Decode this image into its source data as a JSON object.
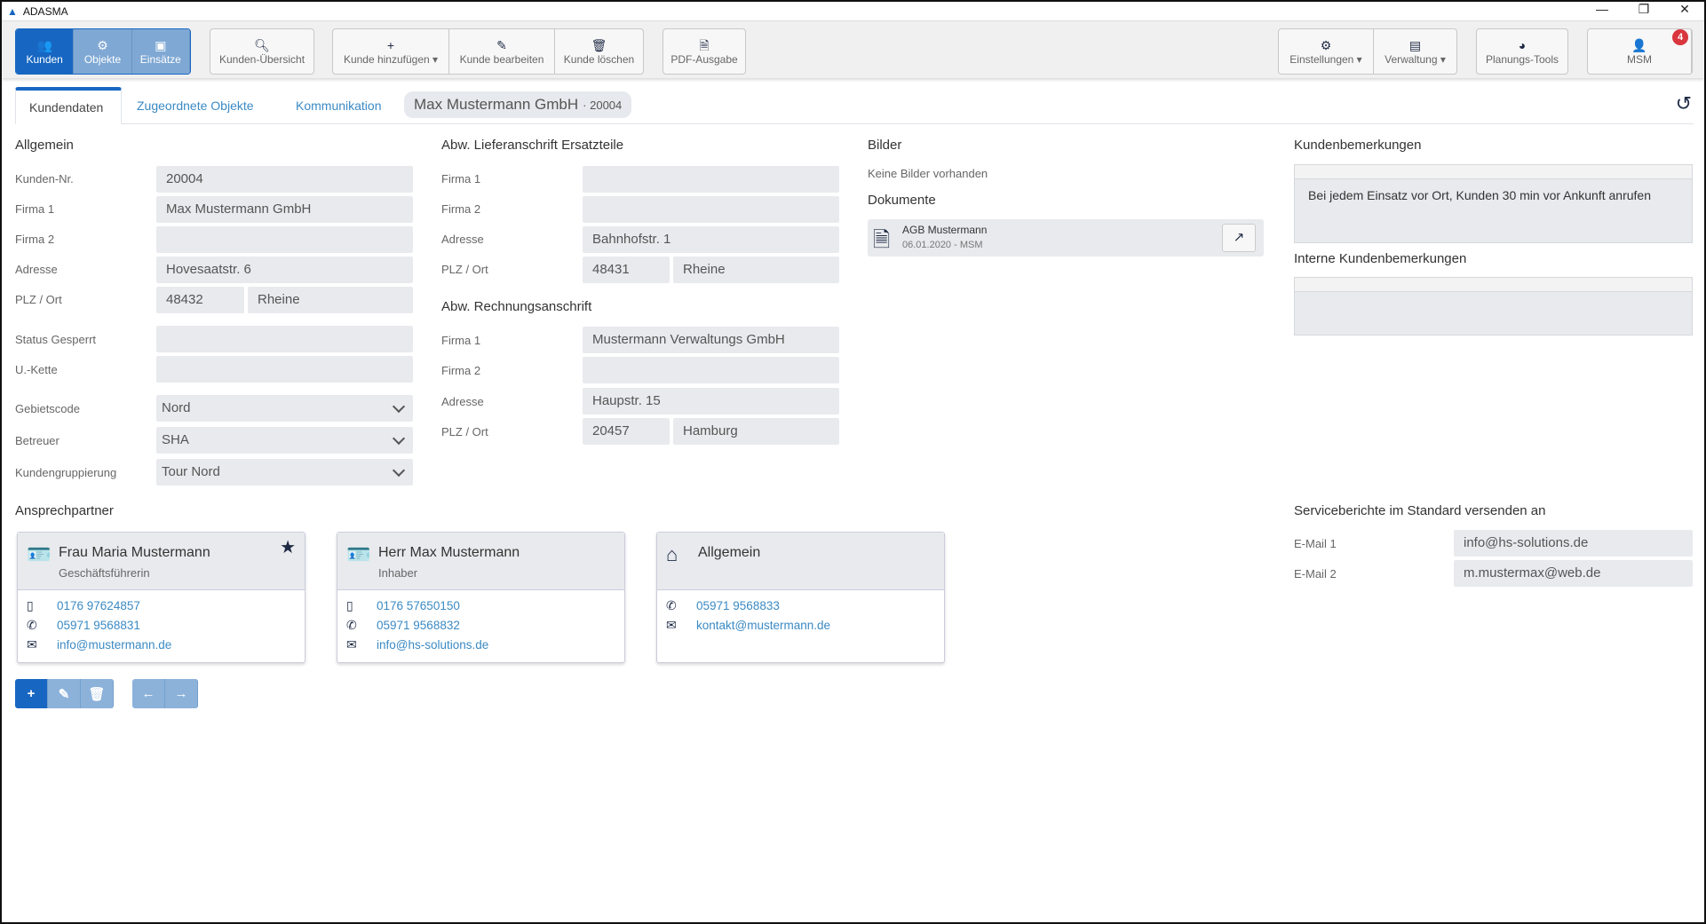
{
  "app": {
    "title": "ADASMA"
  },
  "toolbar": {
    "nav": [
      {
        "label": "Kunden",
        "icon": "users-icon",
        "active": true
      },
      {
        "label": "Objekte",
        "icon": "gear-icon"
      },
      {
        "label": "Einsätze",
        "icon": "toolbox-icon"
      }
    ],
    "overview": "Kunden-Übersicht",
    "add": "Kunde hinzufügen ▾",
    "edit": "Kunde bearbeiten",
    "delete": "Kunde löschen",
    "pdf": "PDF-Ausgabe",
    "settings": "Einstellungen ▾",
    "admin": "Verwaltung ▾",
    "planning": "Planungs-Tools",
    "user": "MSM",
    "user_badge": "4"
  },
  "tabs": {
    "customer_data": "Kundendaten",
    "objects": "Zugeordnete Objekte",
    "communication": "Kommunikation",
    "crumb_name": "Max Mustermann GmbH",
    "crumb_id": "· 20004"
  },
  "general": {
    "title": "Allgemein",
    "labels": {
      "nr": "Kunden-Nr.",
      "firma1": "Firma 1",
      "firma2": "Firma 2",
      "adresse": "Adresse",
      "plz_ort": "PLZ / Ort",
      "status": "Status Gesperrt",
      "kette": "U.-Kette",
      "gebiet": "Gebietscode",
      "betreuer": "Betreuer",
      "gruppe": "Kundengruppierung"
    },
    "values": {
      "nr": "20004",
      "firma1": "Max Mustermann GmbH",
      "firma2": "",
      "adresse": "Hovesaatstr. 6",
      "plz": "48432",
      "ort": "Rheine",
      "status": "",
      "kette": "",
      "gebiet": "Nord",
      "betreuer": "SHA",
      "gruppe": "Tour Nord"
    }
  },
  "delivery": {
    "title": "Abw. Lieferanschrift Ersatzteile",
    "labels": {
      "firma1": "Firma 1",
      "firma2": "Firma 2",
      "adresse": "Adresse",
      "plz_ort": "PLZ / Ort"
    },
    "values": {
      "firma1": "",
      "firma2": "",
      "adresse": "Bahnhofstr. 1",
      "plz": "48431",
      "ort": "Rheine"
    }
  },
  "billing": {
    "title": "Abw. Rechnungsanschrift",
    "labels": {
      "firma1": "Firma 1",
      "firma2": "Firma 2",
      "adresse": "Adresse",
      "plz_ort": "PLZ / Ort"
    },
    "values": {
      "firma1": "Mustermann Verwaltungs GmbH",
      "firma2": "",
      "adresse": "Haupstr. 15",
      "plz": "20457",
      "ort": "Hamburg"
    }
  },
  "media": {
    "images_title": "Bilder",
    "no_images": "Keine Bilder vorhanden",
    "docs_title": "Dokumente",
    "doc": {
      "name": "AGB Mustermann",
      "meta": "06.01.2020 - MSM"
    }
  },
  "remarks": {
    "title": "Kundenbemerkungen",
    "text": "Bei jedem Einsatz vor Ort, Kunden 30 min vor Ankunft anrufen",
    "internal_title": "Interne Kundenbemerkungen",
    "internal_text": ""
  },
  "contacts": {
    "title": "Ansprechpartner",
    "items": [
      {
        "name": "Frau Maria Mustermann",
        "role": "Geschäftsführerin",
        "mobile": "0176 97624857",
        "phone": "05971 9568831",
        "email": "info@mustermann.de"
      },
      {
        "name": "Herr Max Mustermann",
        "role": "Inhaber",
        "mobile": "0176 57650150",
        "phone": "05971 9568832",
        "email": "info@hs-solutions.de"
      },
      {
        "name": "Allgemein",
        "phone": "05971 9568833",
        "email": "kontakt@mustermann.de"
      }
    ]
  },
  "service": {
    "title": "Serviceberichte im Standard versenden an",
    "email1_label": "E-Mail 1",
    "email1": "info@hs-solutions.de",
    "email2_label": "E-Mail 2",
    "email2": "m.mustermax@web.de"
  }
}
